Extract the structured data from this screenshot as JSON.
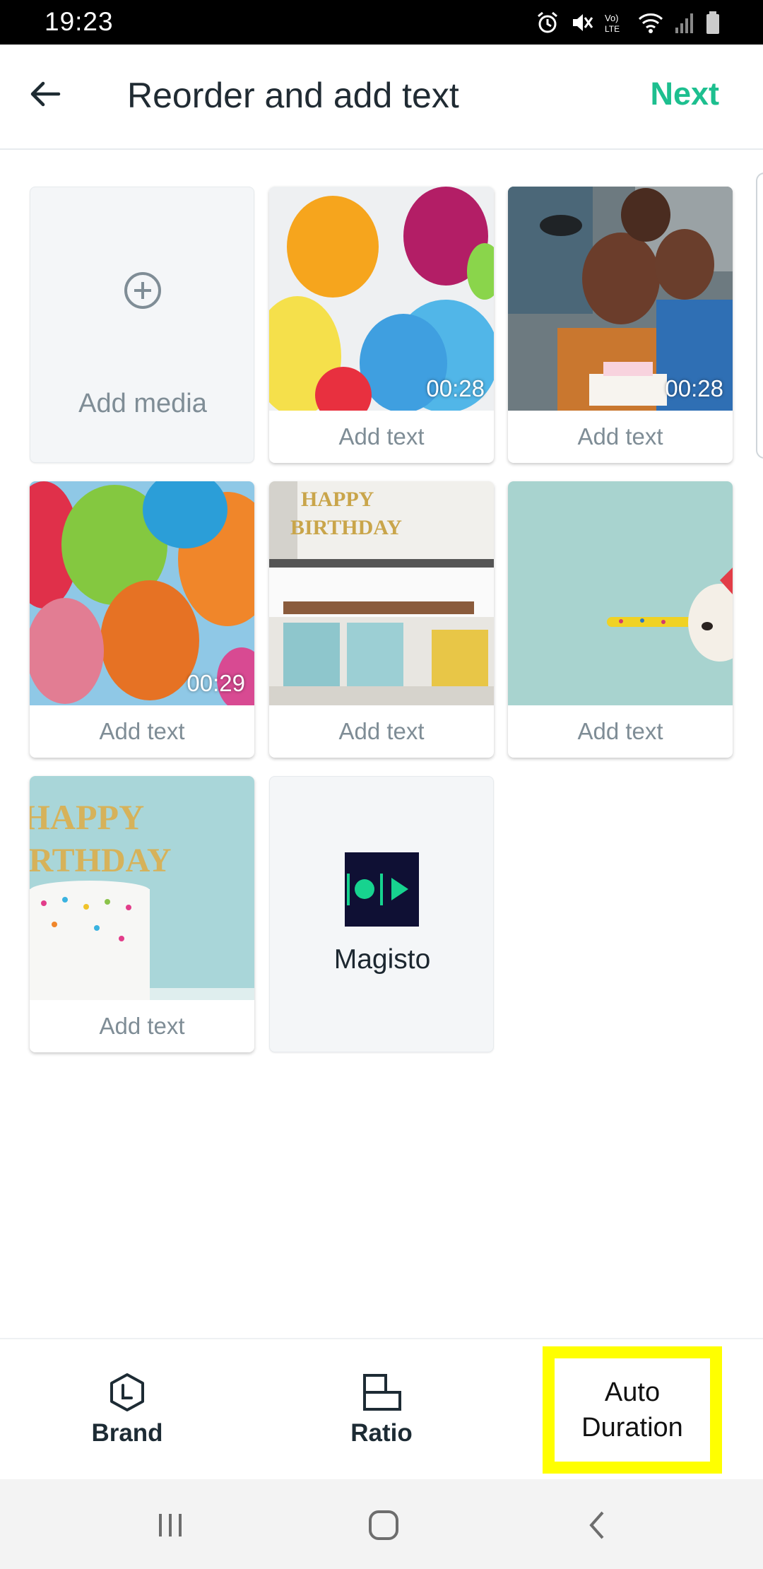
{
  "status_bar": {
    "time": "19:23"
  },
  "header": {
    "title": "Reorder and add text",
    "next_label": "Next"
  },
  "grid": {
    "add_media_label": "Add media",
    "items": [
      {
        "caption": "Add text",
        "duration": "00:28"
      },
      {
        "caption": "Add text",
        "duration": "00:28"
      },
      {
        "caption": "Add text",
        "duration": "00:29"
      },
      {
        "caption": "Add text",
        "duration": ""
      },
      {
        "caption": "Add text",
        "duration": ""
      },
      {
        "caption": "Add text",
        "duration": ""
      }
    ],
    "logo_label": "Magisto"
  },
  "toolbar": {
    "brand_label": "Brand",
    "ratio_label": "Ratio",
    "duration_label_line1": "Auto",
    "duration_label_line2": "Duration"
  },
  "colors": {
    "accent": "#1dbf8f",
    "highlight": "#ffff00",
    "logo_bg": "#0f1034"
  },
  "icons": [
    "back-arrow-icon",
    "plus-circle-icon",
    "brand-hexagon-icon",
    "ratio-icon",
    "recents-icon",
    "home-icon",
    "nav-back-icon"
  ]
}
